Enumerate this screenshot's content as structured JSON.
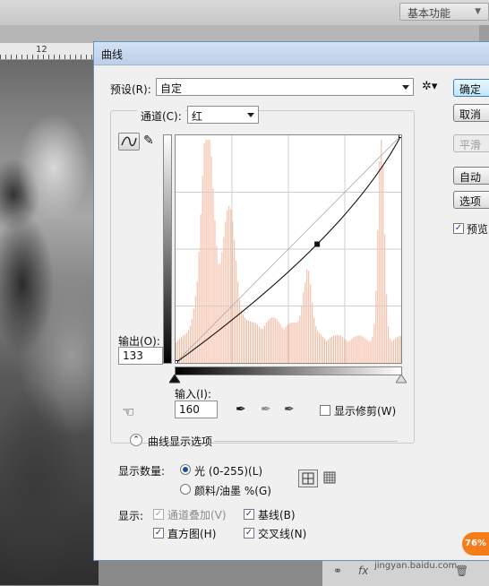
{
  "workspace": {
    "label": "基本功能"
  },
  "ruler": {
    "number": "12"
  },
  "dialog": {
    "title": "曲线",
    "preset": {
      "label": "预设(R):",
      "value": "自定"
    },
    "channel": {
      "label": "通道(C):",
      "value": "红"
    },
    "output": {
      "label": "输出(O):",
      "value": "133"
    },
    "input": {
      "label": "输入(I):",
      "value": "160"
    },
    "show_clipping": {
      "label": "显示修剪(W)",
      "checked": false
    },
    "curve_options_label": "曲线显示选项",
    "display_amount": {
      "label": "显示数量:",
      "options": [
        {
          "label": "光 (0-255)(L)",
          "selected": true
        },
        {
          "label": "颜料/油墨 %(G)",
          "selected": false
        }
      ]
    },
    "show": {
      "label": "显示:",
      "items": [
        {
          "label": "通道叠加(V)",
          "checked": true,
          "disabled": true
        },
        {
          "label": "基线(B)",
          "checked": true
        },
        {
          "label": "直方图(H)",
          "checked": true
        },
        {
          "label": "交叉线(N)",
          "checked": true
        }
      ]
    },
    "buttons": [
      {
        "label": "确定",
        "state": "default"
      },
      {
        "label": "取消",
        "state": "normal"
      },
      {
        "label": "平滑",
        "state": "disabled"
      },
      {
        "label": "自动",
        "state": "normal"
      },
      {
        "label": "选项",
        "state": "normal"
      }
    ],
    "preview": {
      "label": "预览",
      "checked": true
    },
    "curve": {
      "points": [
        [
          0,
          0
        ],
        [
          160,
          133
        ],
        [
          255,
          255
        ]
      ],
      "histogram_color": "#f4b59a"
    }
  },
  "badge": {
    "label": "76%"
  },
  "watermark": "jingyan.baidu.com"
}
